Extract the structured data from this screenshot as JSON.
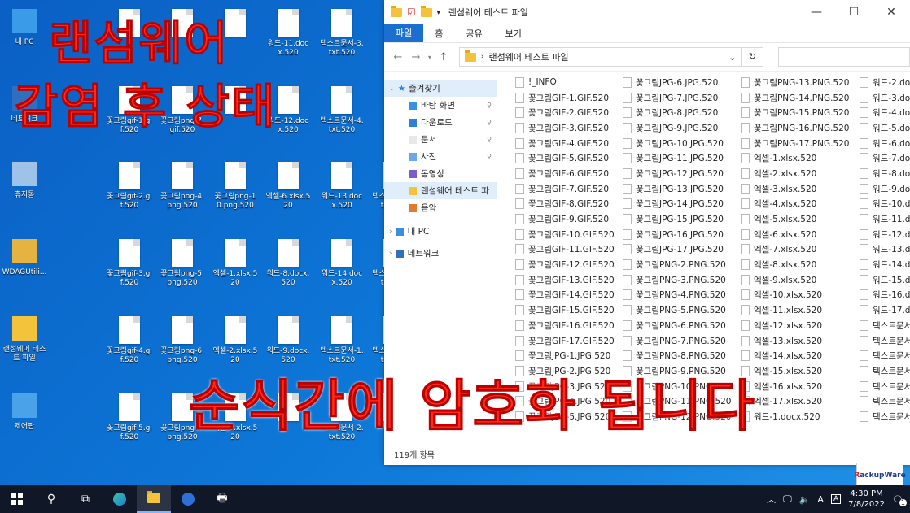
{
  "overlay": {
    "title_line1": "랜섬웨어",
    "title_line2": "감염 후 상태",
    "banner": "순식간에 암호화 됩니다"
  },
  "desktop_icons": [
    {
      "label": "내 PC"
    },
    {
      "label": "네트워크"
    },
    {
      "label": "휴지통"
    },
    {
      "label": "WDAGUtili..."
    },
    {
      "label": "랜섬웨어 테스트 파일"
    },
    {
      "label": "제어판"
    }
  ],
  "desktop_files": [
    {
      "label": ""
    },
    {
      "label": ""
    },
    {
      "label": ""
    },
    {
      "label": "워드-11.docx.520"
    },
    {
      "label": "텍스트문서-3.txt.520"
    },
    {
      "label": "꽃그림gif-1.gif.520"
    },
    {
      "label": "꽃그림png-7.gif.520"
    },
    {
      "label": ""
    },
    {
      "label": "워드-12.docx.520"
    },
    {
      "label": "텍스트문서-4.txt.520"
    },
    {
      "label": "꽃그림gif-2.gif.520"
    },
    {
      "label": "꽃그림png-4.png.520"
    },
    {
      "label": "꽃그림png-10.png.520"
    },
    {
      "label": "엑셀-6.xlsx.520"
    },
    {
      "label": "워드-13.docx.520"
    },
    {
      "label": "텍스트문서-5.txt.520"
    },
    {
      "label": "꽃그림gif-3.gif.520"
    },
    {
      "label": "꽃그림png-5.png.520"
    },
    {
      "label": "엑셀-1.xlsx.520"
    },
    {
      "label": "워드-8.docx.520"
    },
    {
      "label": "워드-14.docx.520"
    },
    {
      "label": "텍스트문서-6.txt.520"
    },
    {
      "label": "꽃그림gif-4.gif.520"
    },
    {
      "label": "꽃그림png-6.png.520"
    },
    {
      "label": "엑셀-2.xlsx.520"
    },
    {
      "label": "워드-9.docx.520"
    },
    {
      "label": "텍스트문서-1.txt.520"
    },
    {
      "label": "텍스트문서-7.txt.520"
    },
    {
      "label": "꽃그림gif-5.gif.520"
    },
    {
      "label": "꽃그림png-7.png.520"
    },
    {
      "label": "엑셀-3.xlsx.520"
    },
    {
      "label": ""
    },
    {
      "label": "텍스트문서-2.txt.520"
    },
    {
      "label": ""
    }
  ],
  "explorer": {
    "title": "랜섬웨어 테스트 파일",
    "ribbon": [
      "파일",
      "홈",
      "공유",
      "보기"
    ],
    "address": "랜섬웨어 테스트 파일",
    "nav": {
      "quick_access": "즐겨찾기",
      "items": [
        "바탕 화면",
        "다운로드",
        "문서",
        "사진",
        "동영상",
        "랜섬웨어 테스트 파",
        "음악"
      ],
      "this_pc": "내 PC",
      "network": "네트워크"
    },
    "columns": [
      [
        "!_INFO",
        "꽃그림GIF-1.GIF.520",
        "꽃그림GIF-2.GIF.520",
        "꽃그림GIF-3.GIF.520",
        "꽃그림GIF-4.GIF.520",
        "꽃그림GIF-5.GIF.520",
        "꽃그림GIF-6.GIF.520",
        "꽃그림GIF-7.GIF.520",
        "꽃그림GIF-8.GIF.520",
        "꽃그림GIF-9.GIF.520",
        "꽃그림GIF-10.GIF.520",
        "꽃그림GIF-11.GIF.520",
        "꽃그림GIF-12.GIF.520",
        "꽃그림GIF-13.GIF.520",
        "꽃그림GIF-14.GIF.520",
        "꽃그림GIF-15.GIF.520",
        "꽃그림GIF-16.GIF.520",
        "꽃그림GIF-17.GIF.520",
        "꽃그림JPG-1.JPG.520",
        "꽃그림JPG-2.JPG.520",
        "꽃그림JPG-3.JPG.520",
        "꽃그림JPG-4.JPG.520",
        "꽃그림JPG-5.JPG.520"
      ],
      [
        "꽃그림JPG-6.JPG.520",
        "꽃그림JPG-7.JPG.520",
        "꽃그림JPG-8.JPG.520",
        "꽃그림JPG-9.JPG.520",
        "꽃그림JPG-10.JPG.520",
        "꽃그림JPG-11.JPG.520",
        "꽃그림JPG-12.JPG.520",
        "꽃그림JPG-13.JPG.520",
        "꽃그림JPG-14.JPG.520",
        "꽃그림JPG-15.JPG.520",
        "꽃그림JPG-16.JPG.520",
        "꽃그림JPG-17.JPG.520",
        "꽃그림PNG-2.PNG.520",
        "꽃그림PNG-3.PNG.520",
        "꽃그림PNG-4.PNG.520",
        "꽃그림PNG-5.PNG.520",
        "꽃그림PNG-6.PNG.520",
        "꽃그림PNG-7.PNG.520",
        "꽃그림PNG-8.PNG.520",
        "꽃그림PNG-9.PNG.520",
        "꽃그림PNG-10.PNG.520",
        "꽃그림PNG-11.PNG.520",
        "꽃그림PNG-12.PNG.520"
      ],
      [
        "꽃그림PNG-13.PNG.520",
        "꽃그림PNG-14.PNG.520",
        "꽃그림PNG-15.PNG.520",
        "꽃그림PNG-16.PNG.520",
        "꽃그림PNG-17.PNG.520",
        "엑셀-1.xlsx.520",
        "엑셀-2.xlsx.520",
        "엑셀-3.xlsx.520",
        "엑셀-4.xlsx.520",
        "엑셀-5.xlsx.520",
        "엑셀-6.xlsx.520",
        "엑셀-7.xlsx.520",
        "엑셀-8.xlsx.520",
        "엑셀-9.xlsx.520",
        "엑셀-10.xlsx.520",
        "엑셀-11.xlsx.520",
        "엑셀-12.xlsx.520",
        "엑셀-13.xlsx.520",
        "엑셀-14.xlsx.520",
        "엑셀-15.xlsx.520",
        "엑셀-16.xlsx.520",
        "엑셀-17.xlsx.520",
        "워드-1.docx.520"
      ],
      [
        "워드-2.docx.520",
        "워드-3.docx.520",
        "워드-4.docx.520",
        "워드-5.docx.520",
        "워드-6.docx.520",
        "워드-7.docx.520",
        "워드-8.docx.520",
        "워드-9.docx.520",
        "워드-10.docx.520",
        "워드-11.docx.520",
        "워드-12.docx.520",
        "워드-13.docx.520",
        "워드-14.docx.520",
        "워드-15.docx.520",
        "워드-16.docx.520",
        "워드-17.docx.520",
        "텍스트문서",
        "텍스트문서",
        "텍스트문서",
        "텍스트문서",
        "텍스트문서",
        "텍스트문서",
        "텍스트문서"
      ]
    ],
    "status": "119개 항목"
  },
  "taskbar": {
    "clock_time": "4:30 PM",
    "clock_date": "7/8/2022",
    "ime": "A",
    "notification_count": "1"
  },
  "brand": {
    "text_r": "R",
    "text_rest": "ackupWare"
  }
}
